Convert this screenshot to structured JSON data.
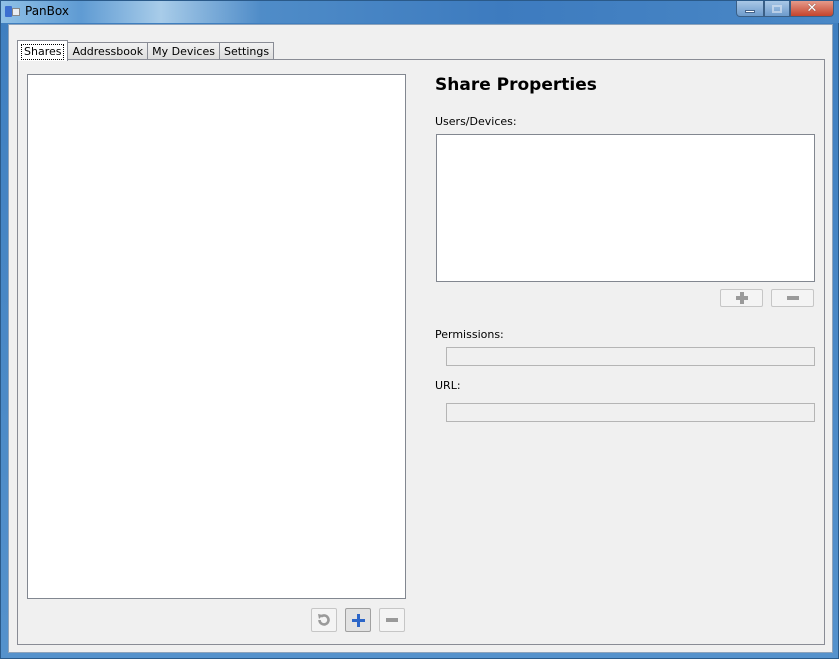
{
  "window": {
    "title": "PanBox",
    "controls": {
      "minimize": "minimize",
      "maximize": "maximize",
      "close": "✕"
    }
  },
  "tabs": [
    {
      "label": "Shares",
      "active": true
    },
    {
      "label": "Addressbook",
      "active": false
    },
    {
      "label": "My Devices",
      "active": false
    },
    {
      "label": "Settings",
      "active": false
    }
  ],
  "shares": {
    "list_items": [],
    "buttons": {
      "refresh": "refresh-icon",
      "add": "plus-icon",
      "remove": "minus-icon"
    }
  },
  "properties": {
    "heading": "Share Properties",
    "users_label": "Users/Devices:",
    "users": [],
    "permissions_label": "Permissions:",
    "permissions_value": "",
    "url_label": "URL:",
    "url_value": ""
  },
  "colors": {
    "accent_blue": "#2c66c8",
    "titlebar": "#3f7fc0",
    "panel": "#f0f0f0"
  }
}
